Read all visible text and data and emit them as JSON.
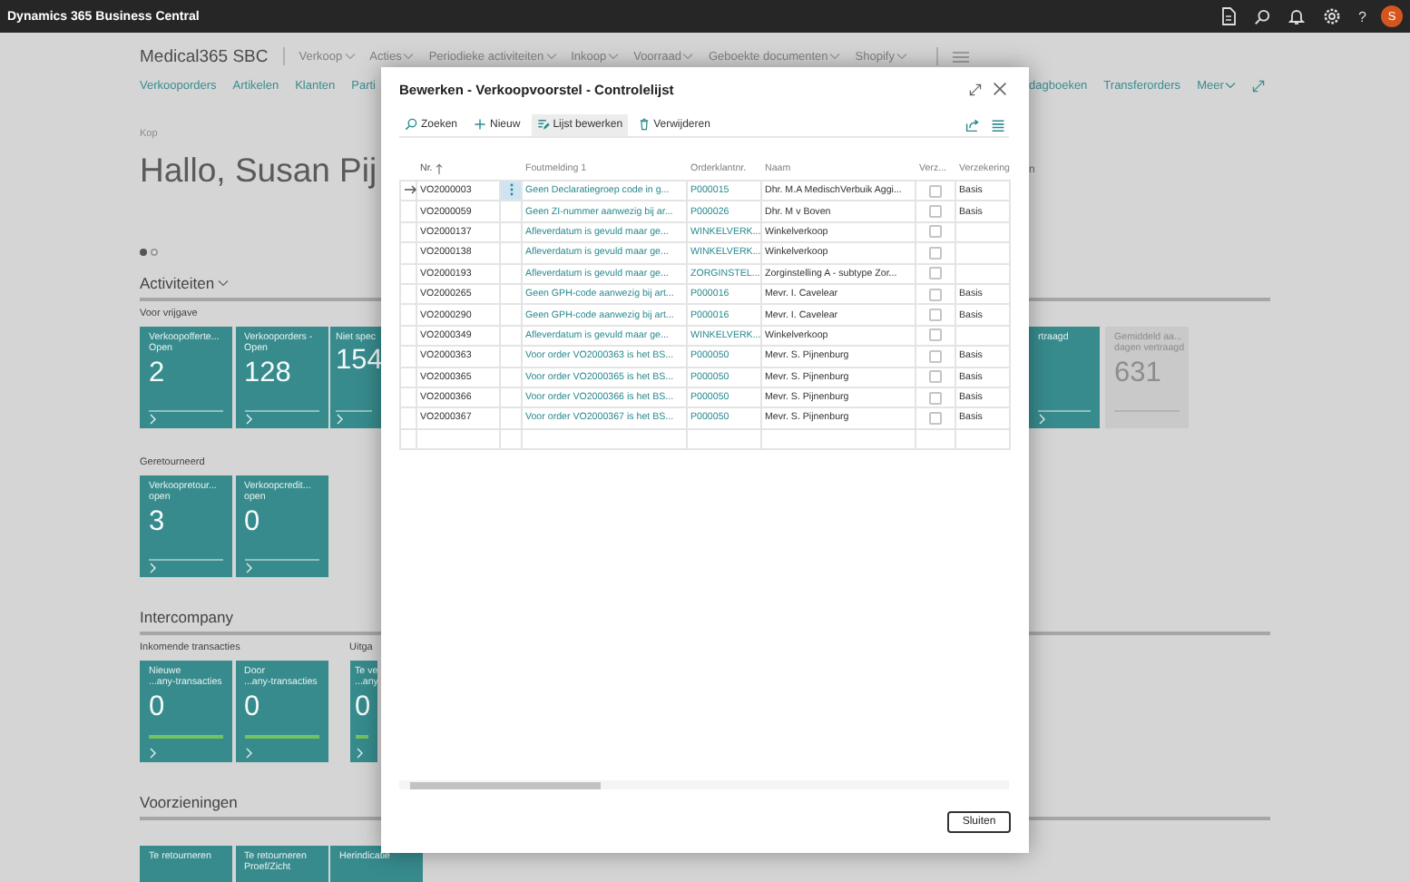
{
  "app_bar": {
    "title": "Dynamics 365 Business Central",
    "help": "?",
    "avatar": "S"
  },
  "company": "Medical365 SBC",
  "menu": [
    {
      "label": "Verkoop"
    },
    {
      "label": "Acties"
    },
    {
      "label": "Periodieke activiteiten"
    },
    {
      "label": "Inkoop"
    },
    {
      "label": "Voorraad"
    },
    {
      "label": "Geboekte documenten"
    },
    {
      "label": "Shopify"
    }
  ],
  "nav_links": [
    {
      "label": "Verkooporders",
      "dropdown": false
    },
    {
      "label": "Artikelen",
      "dropdown": false
    },
    {
      "label": "Klanten",
      "dropdown": false
    },
    {
      "label": "Parti",
      "dropdown": false
    }
  ],
  "nav_links_right": [
    {
      "label": "dagboeken",
      "dropdown": false
    },
    {
      "label": "Transferorders",
      "dropdown": false
    },
    {
      "label": "Meer",
      "dropdown": true
    }
  ],
  "caption": "Kop",
  "greeting": "Hallo, Susan Pij",
  "greeting_right": "n",
  "pager": [
    {
      "selected": true
    },
    {
      "selected": false
    }
  ],
  "sections": [
    {
      "title": "Activiteiten",
      "collapsible": true,
      "rows": [
        {
          "groups": [
            {
              "title": "Voor vrijgave",
              "tiles": [
                {
                  "lines": [
                    "Verkoopofferte...",
                    "Open"
                  ],
                  "value": "2"
                },
                {
                  "lines": [
                    "Verkooporders -",
                    "Open"
                  ],
                  "value": "128"
                },
                {
                  "lines": [
                    "Niet spec"
                  ],
                  "value": "154"
                }
              ]
            }
          ],
          "right_tiles": [
            {
              "lines": [
                "rtraagd"
              ],
              "kind": "accent"
            },
            {
              "lines": [
                "Gemiddeld aa...",
                "dagen vertraagd"
              ],
              "value": "631",
              "kind": "neutral"
            }
          ]
        },
        {
          "groups": [
            {
              "title": "Geretourneerd",
              "tiles": [
                {
                  "lines": [
                    "Verkoopretour...",
                    "open"
                  ],
                  "value": "3"
                },
                {
                  "lines": [
                    "Verkoopcredit...",
                    "open"
                  ],
                  "value": "0"
                }
              ]
            }
          ]
        }
      ]
    },
    {
      "title": "Intercompany",
      "collapsible": false,
      "rows": [
        {
          "groups": [
            {
              "title": "Inkomende transacties",
              "tiles": [
                {
                  "lines": [
                    "Nieuwe",
                    "...any-transacties"
                  ],
                  "value": "0",
                  "color": "#72c35f"
                },
                {
                  "lines": [
                    "Door",
                    "...any-transacties"
                  ],
                  "value": "0",
                  "color": "#72c35f"
                }
              ]
            },
            {
              "title": "Uitga",
              "tiles": [
                {
                  "lines": [
                    "Te ve",
                    "...any"
                  ],
                  "value": "0",
                  "color": "#72c35f"
                }
              ]
            }
          ]
        }
      ]
    },
    {
      "title": "Voorzieningen",
      "collapsible": false,
      "rows": [
        {
          "groups": [
            {
              "tiles": [
                {
                  "lines": [
                    "Te retourneren"
                  ]
                },
                {
                  "lines": [
                    "Te retourneren",
                    "Proef/Zicht"
                  ]
                },
                {
                  "lines": [
                    "Herindicatie"
                  ]
                }
              ]
            }
          ]
        }
      ]
    }
  ],
  "dialog": {
    "title": "Bewerken - Verkoopvoorstel - Controlelijst",
    "toolbar": [
      {
        "label": "Zoeken",
        "kind": "search",
        "selected": false
      },
      {
        "label": "Nieuw",
        "kind": "new",
        "selected": false
      },
      {
        "label": "Lijst bewerken",
        "kind": "edit-list",
        "selected": true
      },
      {
        "label": "Verwijderen",
        "kind": "delete",
        "selected": false
      }
    ],
    "columns": [
      {
        "label": "Nr.",
        "sorted": true
      },
      {
        "label": "Foutmelding 1",
        "sorted": false
      },
      {
        "label": "Orderklantnr.",
        "sorted": false
      },
      {
        "label": "Naam",
        "sorted": false
      },
      {
        "label": "Verz...",
        "sorted": false
      },
      {
        "label": "Verzekering",
        "sorted": false
      }
    ],
    "rows": [
      {
        "selected": true,
        "number": "VO2000003",
        "error": "Geen Declaratiegroep code in g...",
        "customer": "P000015",
        "name": "Dhr. M.A MedischVerbuik Aggi...",
        "checked": false,
        "insurance": "Basis"
      },
      {
        "selected": false,
        "number": "VO2000059",
        "error": "Geen ZI-nummer aanwezig bij ar...",
        "customer": "P000026",
        "name": "Dhr. M v Boven",
        "checked": false,
        "insurance": "Basis"
      },
      {
        "selected": false,
        "number": "VO2000137",
        "error": "Afleverdatum is gevuld maar ge...",
        "customer": "WINKELVERK...",
        "name": "Winkelverkoop",
        "checked": false
      },
      {
        "selected": false,
        "number": "VO2000138",
        "error": "Afleverdatum is gevuld maar ge...",
        "customer": "WINKELVERK...",
        "name": "Winkelverkoop",
        "checked": false
      },
      {
        "selected": false,
        "number": "VO2000193",
        "error": "Afleverdatum is gevuld maar ge...",
        "customer": "ZORGINSTEL...",
        "name": "Zorginstelling A - subtype Zor...",
        "checked": false
      },
      {
        "selected": false,
        "number": "VO2000265",
        "error": "Geen GPH-code aanwezig bij art...",
        "customer": "P000016",
        "name": "Mevr. I. Cavelear",
        "checked": false,
        "insurance": "Basis"
      },
      {
        "selected": false,
        "number": "VO2000290",
        "error": "Geen GPH-code aanwezig bij art...",
        "customer": "P000016",
        "name": "Mevr. I. Cavelear",
        "checked": false,
        "insurance": "Basis"
      },
      {
        "selected": false,
        "number": "VO2000349",
        "error": "Afleverdatum is gevuld maar ge...",
        "customer": "WINKELVERK...",
        "name": "Winkelverkoop",
        "checked": false
      },
      {
        "selected": false,
        "number": "VO2000363",
        "error": "Voor order VO2000363 is het BS...",
        "customer": "P000050",
        "name": "Mevr. S. Pijnenburg",
        "checked": false,
        "insurance": "Basis"
      },
      {
        "selected": false,
        "number": "VO2000365",
        "error": "Voor order VO2000365 is het BS...",
        "customer": "P000050",
        "name": "Mevr. S. Pijnenburg",
        "checked": false,
        "insurance": "Basis"
      },
      {
        "selected": false,
        "number": "VO2000366",
        "error": "Voor order VO2000366 is het BS...",
        "customer": "P000050",
        "name": "Mevr. S. Pijnenburg",
        "checked": false,
        "insurance": "Basis"
      },
      {
        "selected": false,
        "number": "VO2000367",
        "error": "Voor order VO2000367 is het BS...",
        "customer": "P000050",
        "name": "Mevr. S. Pijnenburg",
        "checked": false,
        "insurance": "Basis"
      }
    ],
    "close_button": "Sluiten"
  }
}
